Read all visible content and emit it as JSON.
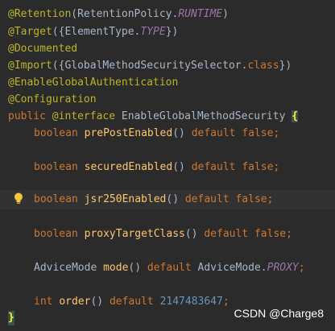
{
  "code": {
    "line1": {
      "ann": "@Retention",
      "open": "(",
      "cls": "RetentionPolicy.",
      "const": "RUNTIME",
      "close": ")"
    },
    "line2": {
      "ann": "@Target",
      "open": "({",
      "cls": "ElementType.",
      "const": "TYPE",
      "close": "})"
    },
    "line3": {
      "ann": "@Documented"
    },
    "line4": {
      "ann": "@Import",
      "open": "({",
      "cls": "GlobalMethodSecuritySelector.",
      "kw": "class",
      "close": "})"
    },
    "line5": {
      "ann": "@EnableGlobalAuthentication"
    },
    "line6": {
      "ann": "@Configuration"
    },
    "decl": {
      "kw": "public",
      "ann": "@interface",
      "name": " EnableGlobalMethodSecurity ",
      "brace": "{"
    },
    "m1": {
      "type": "boolean",
      "name": "prePostEnabled",
      "parens": "()",
      "def": "default",
      "val": "false",
      "semi": ";"
    },
    "m2": {
      "type": "boolean",
      "name": "securedEnabled",
      "parens": "()",
      "def": "default",
      "val": "false",
      "semi": ";"
    },
    "m3": {
      "type": "boolean",
      "name": "jsr250Enabled",
      "parens": "()",
      "def": "default",
      "val": "false",
      "semi": ";"
    },
    "m4": {
      "type": "boolean",
      "name": "proxyTargetClass",
      "parens": "()",
      "def": "default",
      "val": "false",
      "semi": ";"
    },
    "m5": {
      "type": "AdviceMode",
      "name": "mode",
      "parens": "()",
      "def": "default",
      "cls": "AdviceMode.",
      "const": "PROXY",
      "semi": ";"
    },
    "m6": {
      "type": "int",
      "name": "order",
      "parens": "()",
      "def": "default",
      "num": "2147483647",
      "semi": ";"
    },
    "end": {
      "brace": "}"
    }
  },
  "watermark": "CSDN @Charge8",
  "icons": {
    "gutter": "lightbulb-icon"
  },
  "colors": {
    "background": "#2b2b2b",
    "annotation": "#bbb529",
    "keyword": "#cc7832",
    "method": "#ffc66d",
    "constant": "#9876aa",
    "number": "#6897bb",
    "text": "#a9b7c6"
  }
}
